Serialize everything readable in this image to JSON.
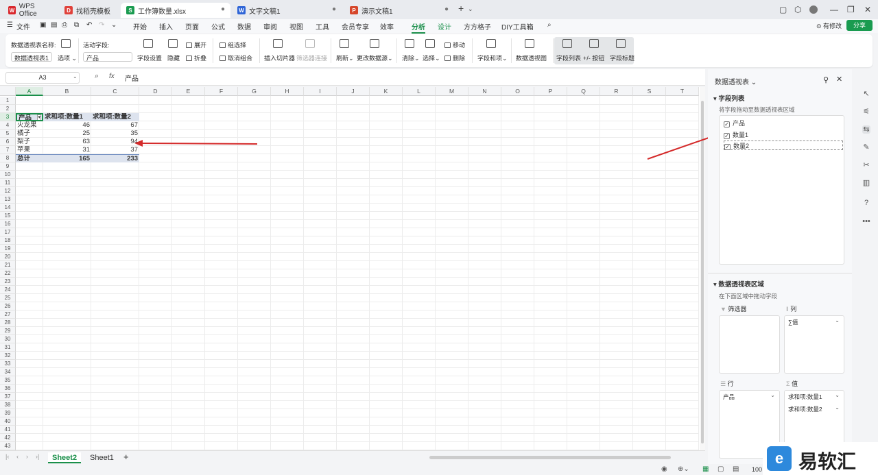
{
  "tabs": [
    {
      "label": "WPS Office",
      "icon_letter": "W",
      "color": "#d9262c"
    },
    {
      "label": "找稻壳模板",
      "icon_letter": "D",
      "color": "#e0413a"
    },
    {
      "label": "工作簿数量.xlsx",
      "icon_letter": "S",
      "color": "#1a9b50"
    },
    {
      "label": "文字文稿1",
      "icon_letter": "W",
      "color": "#2f65d7"
    },
    {
      "label": "演示文稿1",
      "icon_letter": "P",
      "color": "#d6462a"
    }
  ],
  "menu": {
    "file": "文件",
    "items": [
      "开始",
      "插入",
      "页面",
      "公式",
      "数据",
      "审阅",
      "视图",
      "工具",
      "会员专享",
      "效率",
      "分析",
      "设计",
      "方方格子",
      "DIY工具箱"
    ],
    "active": "分析",
    "modify": "有修改",
    "share": "分享"
  },
  "ribbon": {
    "pivot_name_label": "数据透视表名称:",
    "pivot_name_value": "数据透视表1",
    "options": "选项",
    "active_field_label": "活动字段:",
    "active_field_value": "产品",
    "field_settings": "字段设置",
    "hide": "隐藏",
    "expand": "展开",
    "collapse": "折叠",
    "group_selection": "组选择",
    "ungroup": "取消组合",
    "insert_slicer": "插入切片器",
    "filter_connection": "筛选器连接",
    "refresh": "刷新",
    "change_source": "更改数据源",
    "clear": "清除",
    "select": "选择",
    "move": "移动",
    "delete": "删除",
    "fields_items": "字段和项",
    "pivot_view": "数据透视图",
    "field_list": "字段列表",
    "plus_minus": "+/- 按钮",
    "field_headers": "字段标题"
  },
  "formula": {
    "cell_ref": "A3",
    "fx": "fx",
    "content": "产品"
  },
  "columns": [
    "A",
    "B",
    "C",
    "D",
    "E",
    "F",
    "G",
    "H",
    "I",
    "J",
    "K",
    "L",
    "M",
    "N",
    "O",
    "P",
    "Q",
    "R",
    "S",
    "T"
  ],
  "rows_count": 43,
  "pivot": {
    "headers": [
      "产品",
      "求和项:数量1",
      "求和项:数量2"
    ],
    "rows": [
      [
        "火龙果",
        "46",
        "67"
      ],
      [
        "橘子",
        "25",
        "35"
      ],
      [
        "梨子",
        "63",
        "94"
      ],
      [
        "苹果",
        "31",
        "37"
      ]
    ],
    "total": [
      "总计",
      "165",
      "233"
    ]
  },
  "sheets": [
    "Sheet2",
    "Sheet1"
  ],
  "active_sheet": "Sheet2",
  "panel": {
    "title": "数据透视表",
    "field_list_title": "字段列表",
    "field_list_hint": "将字段拖动至数据透视表区域",
    "fields": [
      "产品",
      "数量1",
      "数量2"
    ],
    "area_title": "数据透视表区域",
    "area_hint": "在下面区域中拖动字段",
    "filter_label": "筛选器",
    "column_label": "列",
    "column_value": "∑值",
    "row_label": "行",
    "row_value": "产品",
    "value_label": "值",
    "values": [
      "求和项:数量1",
      "求和项:数量2"
    ]
  },
  "status": {
    "zoom": "100"
  },
  "watermark": "易软汇",
  "accent_color": "#1a8f4a",
  "arrow_color": "#d42a2a"
}
